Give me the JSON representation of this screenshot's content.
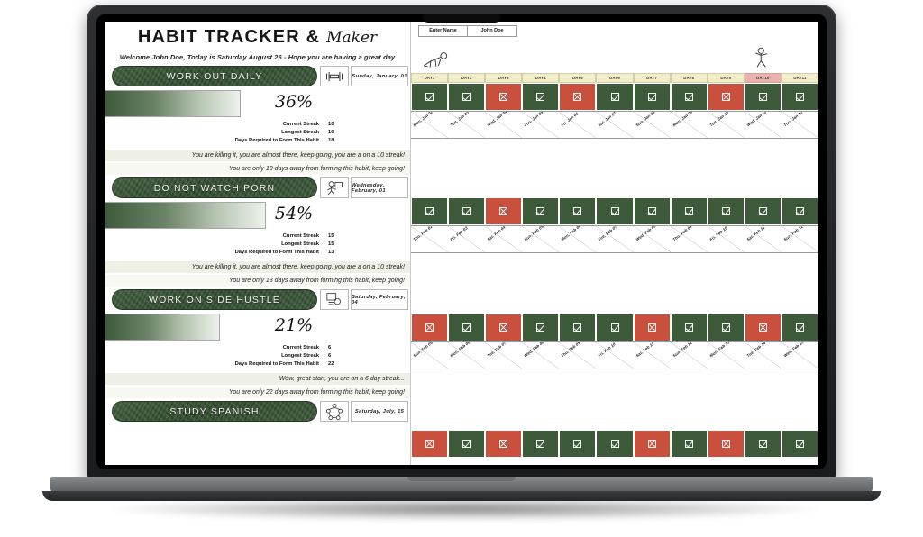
{
  "document": {
    "title_main": "HABIT TRACKER &",
    "title_script": "Maker",
    "welcome": "Welcome John Doe, Today is Saturday August 26 -  Hope you are having a great day"
  },
  "name_entry": {
    "label": "Enter Name",
    "value": "John Doe"
  },
  "stat_labels": {
    "current_streak": "Current Streak",
    "longest_streak": "Longest Streak",
    "days_required": "Days Required to Form This Habit"
  },
  "day_headers": [
    "DAY1",
    "DAY2",
    "DAY3",
    "DAY4",
    "DAY5",
    "DAY6",
    "DAY7",
    "DAY8",
    "DAY9",
    "DAY10",
    "DAY11"
  ],
  "day_header_hot_index": 9,
  "colors": {
    "done_green": "#3d5a3b",
    "miss_red": "#c9503d",
    "header_cream": "#f2edc9",
    "header_hot": "#e8b3ae",
    "message_band": "#eef0e6",
    "habit_pill": "#2f4a2d"
  },
  "habits": [
    {
      "name": "WORK OUT DAILY",
      "icon": "dumbbell-icon",
      "date": "Sunday,  January,  01",
      "percent": "36%",
      "percent_value": 36,
      "current_streak": "10",
      "longest_streak": "10",
      "days_required": "18",
      "message_1": "You are killing it, you are almost there, keep going, you are a on a 10 streak!",
      "message_2": "You are only  18 days away from forming this habit, keep going!",
      "marks": [
        "done",
        "done",
        "miss",
        "done",
        "miss",
        "done",
        "done",
        "done",
        "miss",
        "done",
        "done"
      ],
      "dates": [
        "Mon,  Jan 02",
        "Tue,  Jan 03",
        "Wed,  Jan 04",
        "Thu,  Jan 05",
        "Fri,  Jan 06",
        "Sat,  Jan 07",
        "Sun,  Jan 08",
        "Mon,  Jan 09",
        "Tue,  Jan 10",
        "Wed,  Jan 11",
        "Thu,  Jan 12"
      ]
    },
    {
      "name": "DO NOT WATCH PORN",
      "icon": "no-screen-icon",
      "date": "Wednesday,  February,  01",
      "percent": "54%",
      "percent_value": 54,
      "current_streak": "15",
      "longest_streak": "15",
      "days_required": "13",
      "message_1": "You are killing it, you are almost there, keep going, you are a on a 10 streak!",
      "message_2": "You are only 13 days away from forming this habit, keep going!",
      "marks": [
        "done",
        "done",
        "miss",
        "done",
        "done",
        "done",
        "done",
        "done",
        "done",
        "done",
        "done"
      ],
      "dates": [
        "Thu,  Feb 02",
        "Fri,  Feb 03",
        "Sat,  Feb 04",
        "Sun,  Feb 05",
        "Mon,  Feb 06",
        "Tue,  Feb 07",
        "Wed,  Feb 08",
        "Thu,  Feb 09",
        "Fri,  Feb 10",
        "Sat,  Feb 11",
        "Sun,  Feb 12"
      ]
    },
    {
      "name": "WORK ON SIDE HUSTLE",
      "icon": "laptop-person-icon",
      "date": "Saturday,  February,  04",
      "percent": "21%",
      "percent_value": 21,
      "current_streak": "6",
      "longest_streak": "6",
      "days_required": "22",
      "message_1": "Wow, great start, you are on a 6 day streak...",
      "message_2": "You are only 22 days away from forming this habit, keep going!",
      "marks": [
        "miss",
        "done",
        "miss",
        "done",
        "done",
        "done",
        "miss",
        "done",
        "done",
        "miss",
        "done"
      ],
      "dates": [
        "Sun,  Feb 05",
        "Mon,  Feb 06",
        "Tue,  Feb 07",
        "Wed,  Feb 08",
        "Thu,  Feb 09",
        "Fri,  Feb 10",
        "Sat,  Feb 11",
        "Sun,  Feb 12",
        "Mon,  Feb 13",
        "Tue,  Feb 14",
        "Wed,  Feb 15"
      ]
    },
    {
      "name": "STUDY SPANISH",
      "icon": "network-icon",
      "date": "Saturday,  July,  15",
      "percent": "",
      "percent_value": 0,
      "current_streak": "",
      "longest_streak": "",
      "days_required": "",
      "message_1": "",
      "message_2": "",
      "marks": [
        "miss",
        "done",
        "miss",
        "done",
        "done",
        "done",
        "miss",
        "done",
        "miss",
        "done",
        "done"
      ],
      "dates": []
    }
  ]
}
